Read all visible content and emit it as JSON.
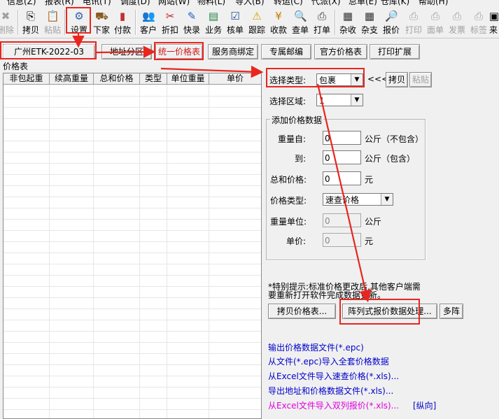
{
  "menu": [
    "信息(Z)",
    "报表(R)",
    "电讯(T)",
    "调度(D)",
    "网站(W)",
    "物料(L)",
    "导入(B)",
    "转运(C)",
    "代派(X)",
    "总单(E)",
    "仓库(K)",
    "帮助(H)"
  ],
  "toolbar": {
    "delete": "删除",
    "copy": "拷贝",
    "paste": "粘贴",
    "settings": "设置",
    "xiajia": "下家",
    "fukuan": "付款",
    "customer": "客户",
    "discount": "折扣",
    "express": "快录",
    "business": "业务",
    "verify": "核单",
    "track": "跟踪",
    "collect": "收款",
    "query": "查单",
    "print_order": "打单",
    "misc_in": "杂收",
    "misc_out": "杂支",
    "quote": "报价",
    "print": "打印",
    "face_sheet": "面单",
    "invoice": "发票",
    "label": "标签",
    "come": "来"
  },
  "tabs": {
    "account": "广州ETK-2022-03",
    "zone": "地址分区",
    "unified": "统一价格表",
    "service": "服务商绑定",
    "postcode": "专属邮编",
    "official": "官方价格表",
    "print_ext": "打印扩展"
  },
  "price_table": {
    "title": "价格表",
    "columns": [
      "非包起重",
      "续高重量",
      "总和价格",
      "类型",
      "单位重量",
      "单价"
    ]
  },
  "panel": {
    "select_type_label": "选择类型:",
    "select_type_value": "包裹",
    "arrows": "<<<",
    "copy_btn": "拷贝",
    "paste_btn": "粘贴",
    "select_zone_label": "选择区域:",
    "select_zone_value": "1",
    "group_title": "添加价格数据",
    "weight_from_label": "重量自:",
    "weight_from_value": "0",
    "weight_from_unit": "公斤（不包含）",
    "to_label": "到:",
    "to_value": "0",
    "to_unit": "公斤（包含）",
    "total_price_label": "总和价格:",
    "total_price_value": "0",
    "total_price_unit": "元",
    "price_type_label": "价格类型:",
    "price_type_value": "速查价格",
    "weight_unit_label": "重量单位:",
    "weight_unit_value": "0",
    "weight_unit_unit": "公斤",
    "unit_price_label": "单价:",
    "unit_price_value": "0",
    "unit_price_unit": "元",
    "tip_line1": "*特别提示:标准价格更改后,其他客户端需",
    "tip_line2": "要重新打开软件完成数据更新。",
    "copy_price_btn": "拷贝价格表...",
    "matrix_btn": "阵列式报价数据处理...",
    "multi_btn": "多阵"
  },
  "links": {
    "export_epc": "输出价格数据文件(*.epc)",
    "import_epc": "从文件(*.epc)导入全套价格数据",
    "import_xls_fast": "从Excel文件导入速查价格(*.xls)...",
    "import_addr": "导出地址和价格数据文件(*.xls)...",
    "import_dual": "从Excel文件导入双列报价(*.xls)...",
    "vertical": "[纵向]"
  },
  "colors": {
    "annotation_red": "#e8261f",
    "link_blue": "#0000cc",
    "link_magenta": "#e000e0"
  }
}
